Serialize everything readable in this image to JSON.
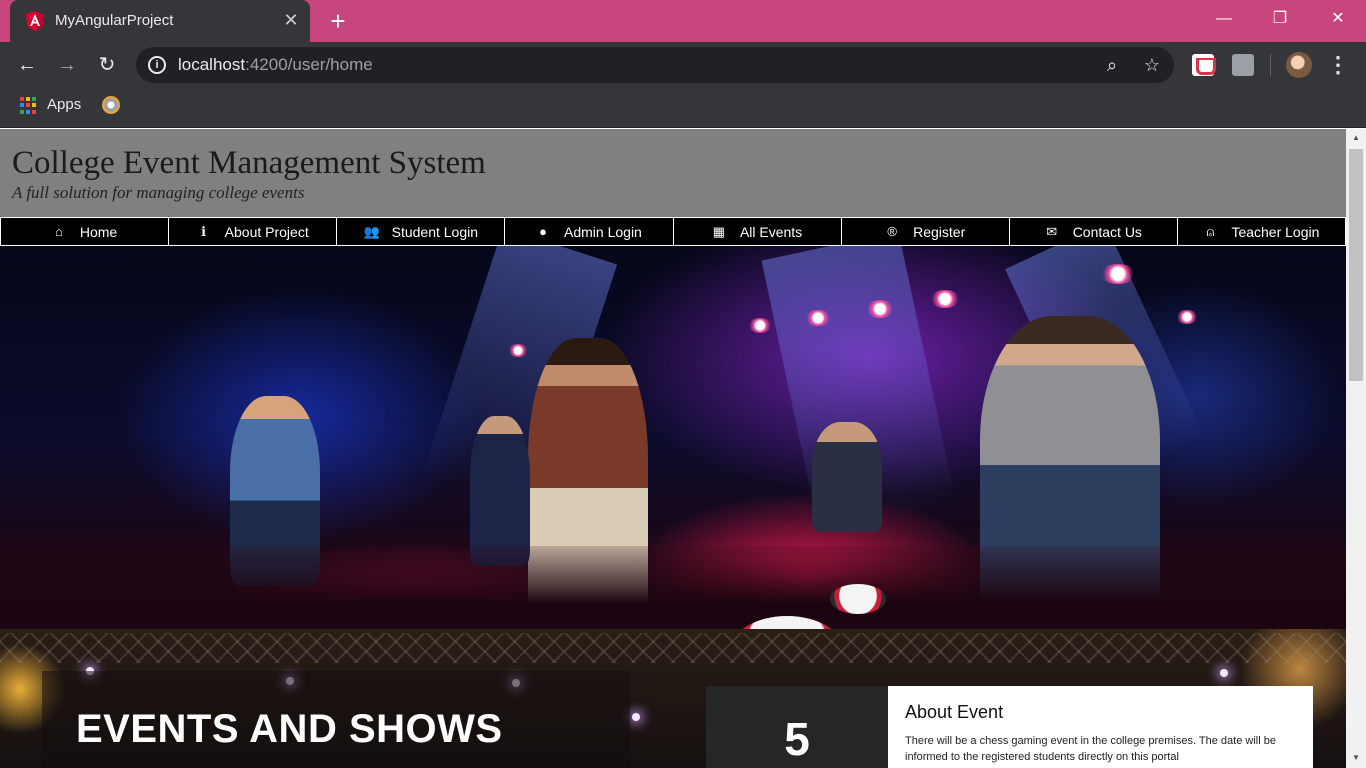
{
  "browser": {
    "tab_title": "MyAngularProject",
    "tab_close": "✕",
    "new_tab": "+",
    "window_minimize": "—",
    "window_restore": "❐",
    "window_close": "✕",
    "back": "←",
    "forward": "→",
    "reload": "↻",
    "url_host": "localhost",
    "url_path": ":4200/user/home",
    "zoom_icon": "⌕",
    "star_icon": "☆",
    "menu_icon": "⋮",
    "bookmarks": {
      "apps_label": "Apps"
    },
    "colors": {
      "tab_strip": "#c8467e",
      "toolbar": "#35363a"
    }
  },
  "site": {
    "title": "College Event Management System",
    "tagline": "A full solution for managing college events"
  },
  "nav": {
    "items": [
      {
        "label": "Home",
        "icon": "home-icon",
        "glyph": "⌂"
      },
      {
        "label": "About Project",
        "icon": "info-icon",
        "glyph": "ℹ"
      },
      {
        "label": "Student Login",
        "icon": "users-icon",
        "glyph": "👥"
      },
      {
        "label": "Admin Login",
        "icon": "user-icon",
        "glyph": "●"
      },
      {
        "label": "All Events",
        "icon": "calendar-icon",
        "glyph": "▦"
      },
      {
        "label": "Register",
        "icon": "registered-icon",
        "glyph": "®"
      },
      {
        "label": "Contact Us",
        "icon": "envelope-icon",
        "glyph": "✉"
      },
      {
        "label": "Teacher Login",
        "icon": "user-outline-icon",
        "glyph": "⍝"
      }
    ]
  },
  "events": {
    "heading": "EVENTS AND SHOWS",
    "event_number": "5",
    "card_title": "About Event",
    "card_text": "There will be a chess gaming event in the college premises. The date will be informed to the registered students directly on this portal"
  }
}
